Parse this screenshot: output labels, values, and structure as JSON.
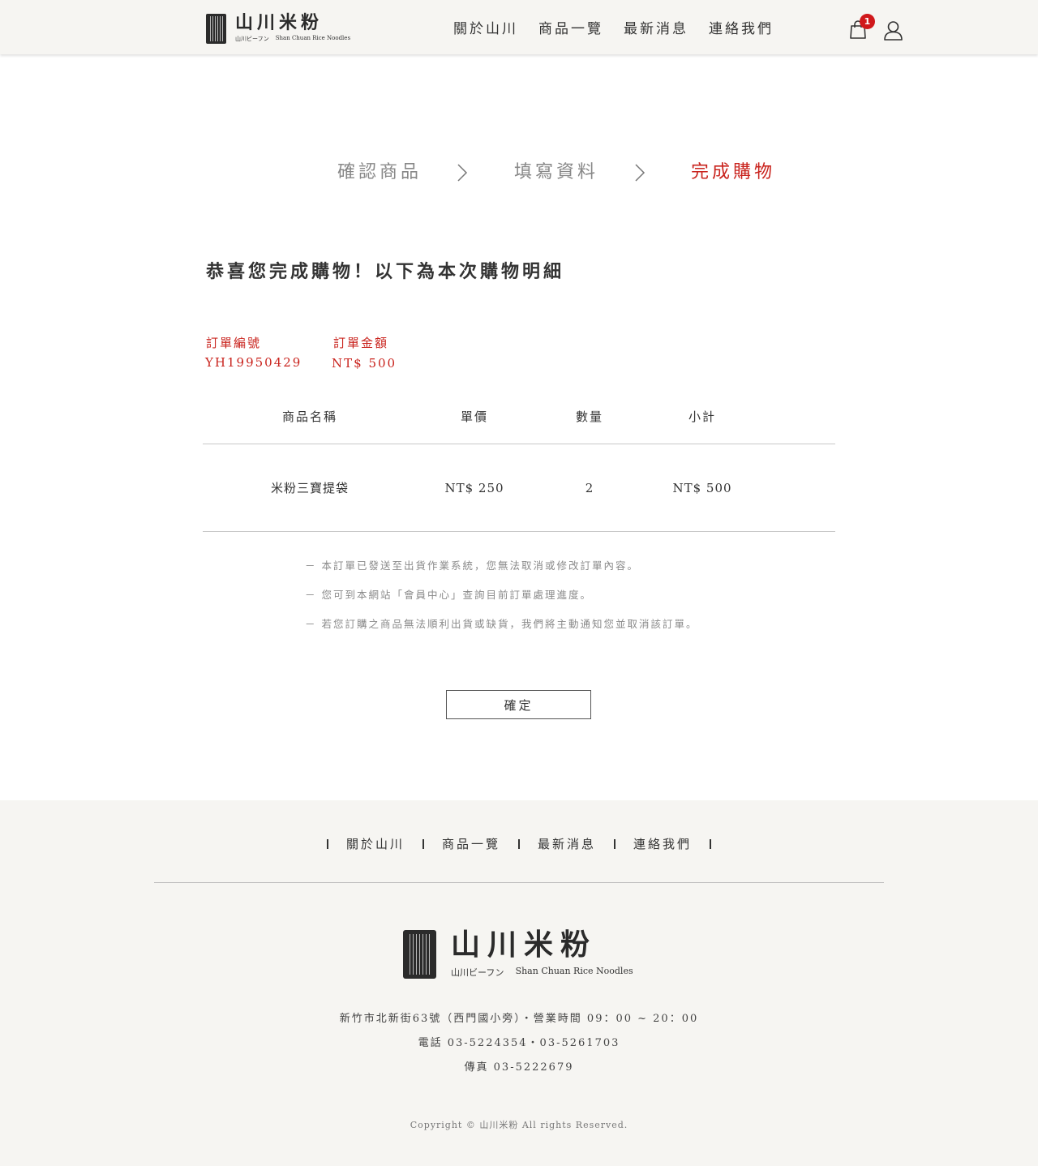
{
  "header": {
    "logo_cn": "山川米粉",
    "logo_jp": "山川ビーフン",
    "logo_en": "Shan Chuan Rice Noodles",
    "nav": [
      "關於山川",
      "商品一覽",
      "最新消息",
      "連絡我們"
    ],
    "cart_count": "1",
    "cart_icon": "cart-icon",
    "user_icon": "user-icon"
  },
  "steps": {
    "items": [
      "確認商品",
      "填寫資料",
      "完成購物"
    ],
    "active_index": 2,
    "active_color": "#c9231d"
  },
  "heading": "恭喜您完成購物！以下為本次購物明細",
  "order": {
    "number_label": "訂單編號",
    "number_value": "YH19950429",
    "amount_label": "訂單金額",
    "amount_value": "NT$ 500"
  },
  "table": {
    "headers": [
      "商品名稱",
      "單價",
      "數量",
      "小計"
    ],
    "rows": [
      [
        "米粉三寶提袋",
        "NT$ 250",
        "2",
        "NT$ 500"
      ]
    ]
  },
  "notes": [
    "－ 本訂單已發送至出貨作業系統，您無法取消或修改訂單內容。",
    "－ 您可到本網站「會員中心」查詢目前訂單處理進度。",
    "－ 若您訂購之商品無法順利出貨或缺貨，我們將主動通知您並取消該訂單。"
  ],
  "confirm_label": "確定",
  "footer": {
    "nav": [
      "關於山川",
      "商品一覽",
      "最新消息",
      "連絡我們"
    ],
    "logo_cn": "山川米粉",
    "logo_jp": "山川ビーフン",
    "logo_en": "Shan Chuan Rice Noodles",
    "address": "新竹市北新街63號（西門國小旁）・營業時間 09：00 ~ 20：00",
    "phone": "電話 03-5224354・03-5261703",
    "fax": "傳真 03-5222679",
    "copyright": "Copyright © 山川米粉 All rights Reserved."
  }
}
